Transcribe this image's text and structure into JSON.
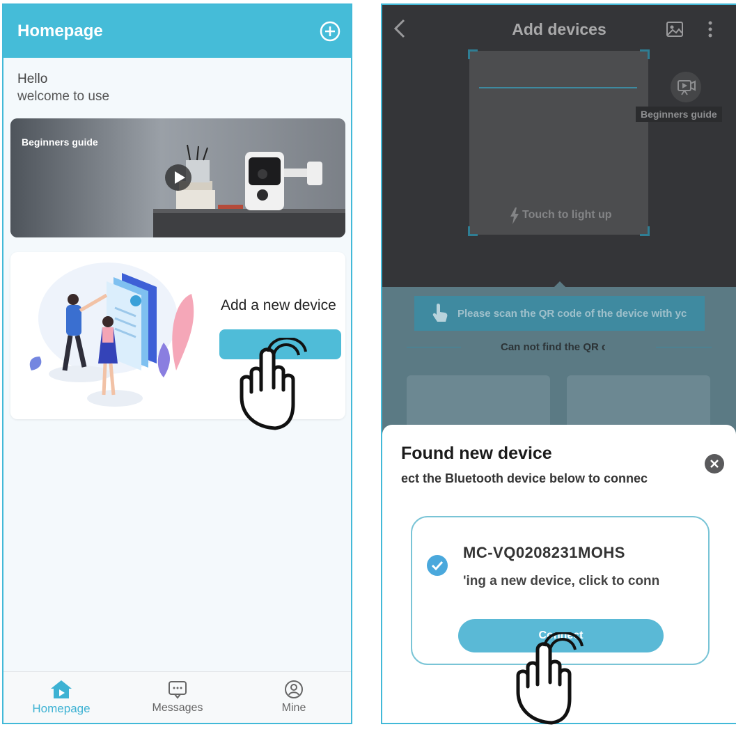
{
  "homepage": {
    "title": "Homepage",
    "greeting_line1": "Hello",
    "greeting_line2": "welcome to use",
    "banner_label": "Beginners guide",
    "add_card_title": "Add a new device",
    "add_card_button": "",
    "tabs": [
      {
        "label": "Homepage",
        "icon": "home-icon",
        "active": true
      },
      {
        "label": "Messages",
        "icon": "message-icon",
        "active": false
      },
      {
        "label": "Mine",
        "icon": "profile-icon",
        "active": false
      }
    ],
    "accent_color": "#45bcd8"
  },
  "add_devices": {
    "title": "Add devices",
    "flash_label": "Touch to light up",
    "guide_label": "Beginners guide",
    "scan_hint": "Please scan the QR code of the device with yc",
    "qr_help": "Can not find the QR c",
    "sheet": {
      "title": "Found new device",
      "subtitle": "ect the Bluetooth device below to connec",
      "device_name": "MC-VQ0208231MOHS",
      "device_desc": "'ing a new device, click to conn",
      "connect_button": "Connect"
    }
  }
}
